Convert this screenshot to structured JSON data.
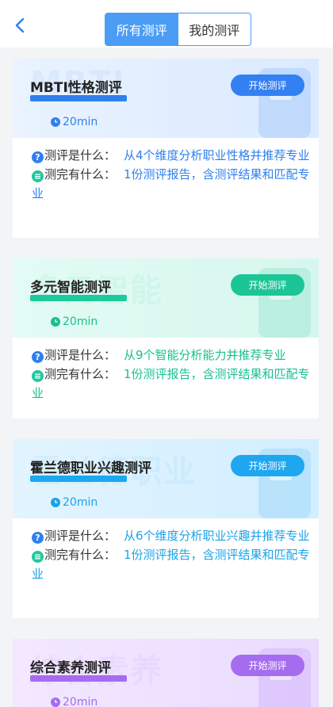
{
  "header": {
    "back_icon": "chevron-left-icon",
    "tabs": [
      {
        "label": "所有测评",
        "active": true
      },
      {
        "label": "我的测评",
        "active": false
      }
    ]
  },
  "cards": [
    {
      "title": "MBTI性格测评",
      "watermark": "MBTI",
      "start_label": "开始测评",
      "duration": "20min",
      "what_label": "测评是什么：",
      "what_value": "从4个维度分析职业性格并推荐专业",
      "result_label": "测完有什么：",
      "result_value": "1份测评报告，含测评结果和匹配专业",
      "accent": "#2f80ed"
    },
    {
      "title": "多元智能测评",
      "watermark": "多元智能",
      "start_label": "开始测评",
      "duration": "20min",
      "what_label": "测评是什么：",
      "what_value": "从9个智能分析能力并推荐专业",
      "result_label": "测完有什么：",
      "result_value": "1份测评报告，含测评结果和匹配专业",
      "accent": "#18c08f"
    },
    {
      "title": "霍兰德职业兴趣测评",
      "watermark": "霍兰德职业",
      "start_label": "开始测评",
      "duration": "20min",
      "what_label": "测评是什么：",
      "what_value": "从6个维度分析职业兴趣并推荐专业",
      "result_label": "测完有什么：",
      "result_value": "1份测评报告，含测评结果和匹配专业",
      "accent": "#1aa3ea"
    },
    {
      "title": "综合素养测评",
      "watermark": "综合素养",
      "start_label": "开始测评",
      "duration": "20min",
      "accent": "#a46cf0"
    }
  ]
}
